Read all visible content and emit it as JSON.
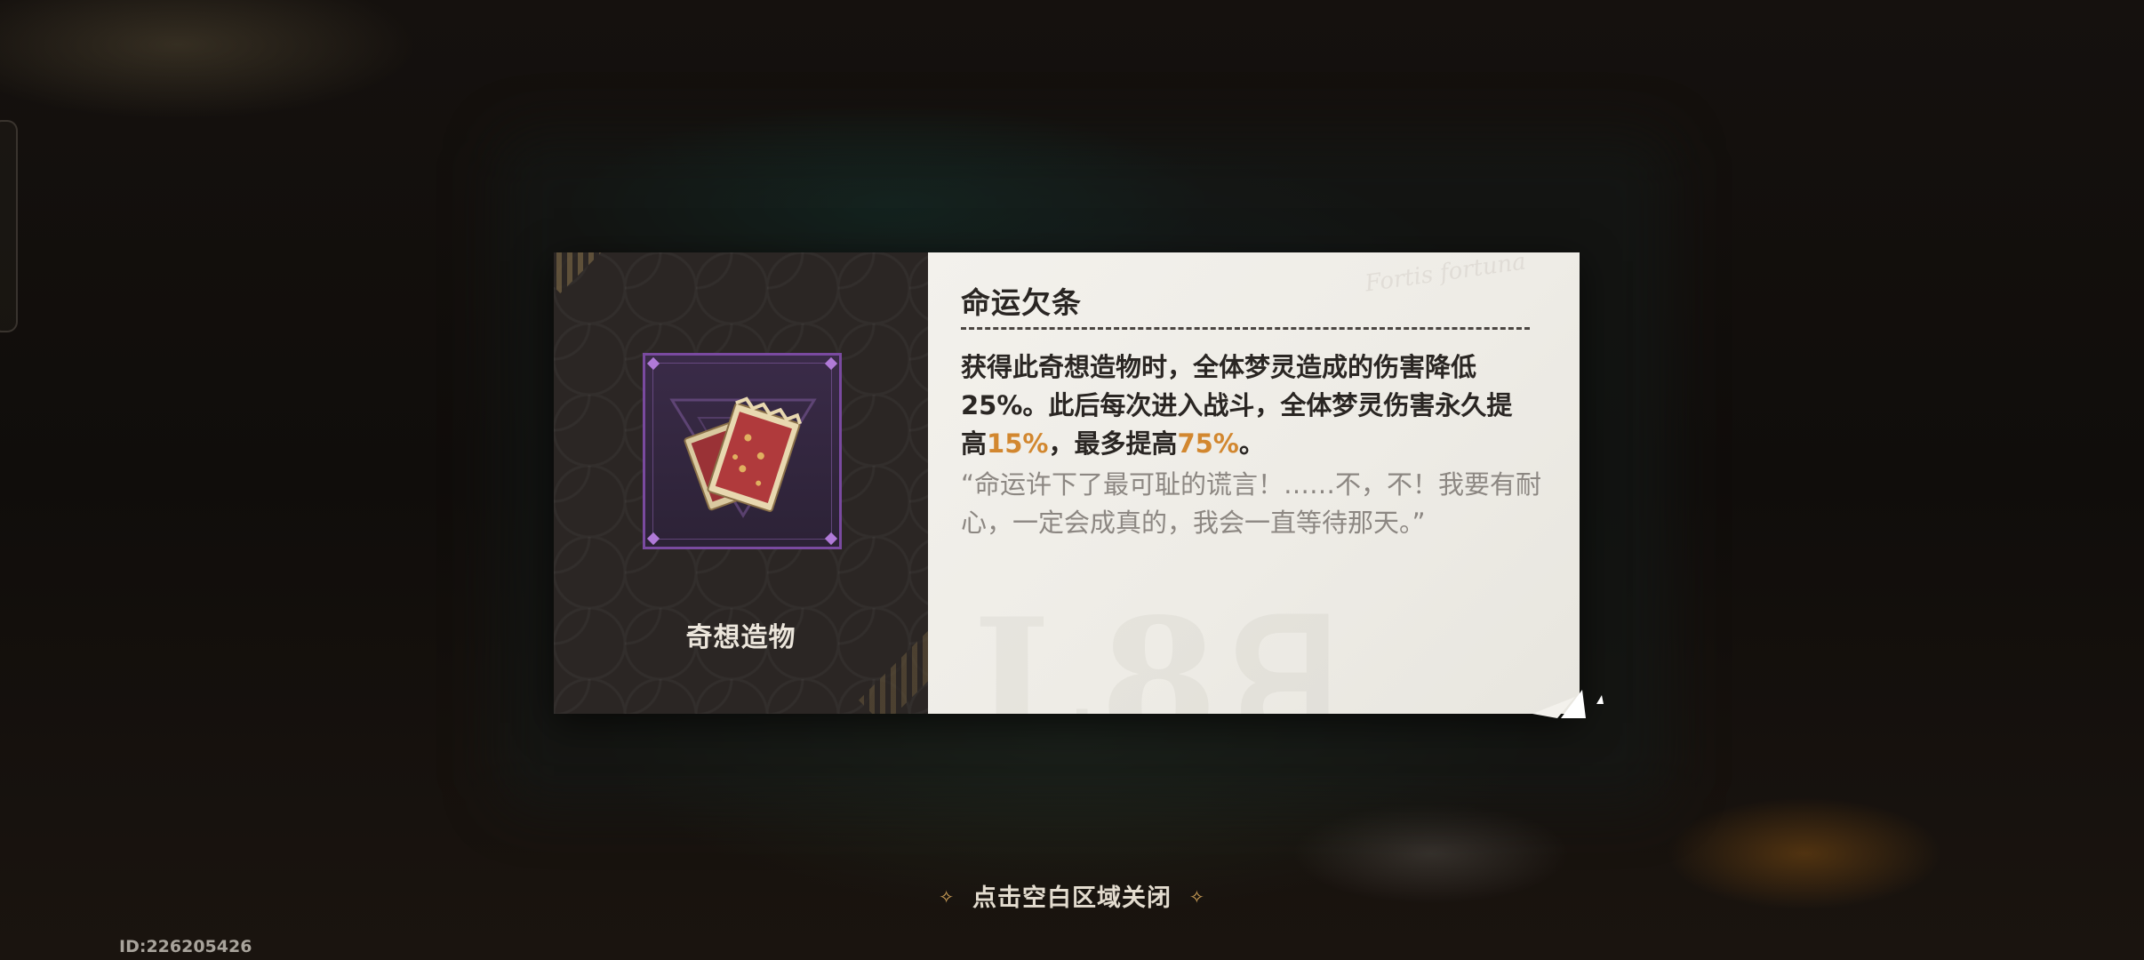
{
  "item": {
    "title": "命运欠条",
    "category": "奇想造物",
    "description": {
      "line1": "获得此奇想造物时，全体梦灵造成的伤害降低",
      "line2": "25%。此后每次进入战斗，全体梦灵伤害永久提",
      "line3_prefix": "高",
      "value_increase": "15%",
      "line3_mid": "，最多提高",
      "value_max": "75%",
      "line3_suffix": "。"
    },
    "flavor_text": "“命运许下了最可耻的谎言！……不，不！我要有耐心，一定会成真的，我会一直等待那天。”"
  },
  "close_hint": "点击空白区域关闭",
  "uid": "ID:226205426",
  "colors": {
    "highlight": "#d2872f",
    "frame_purple": "#7a4aa0",
    "card_dark": "#2b2624",
    "card_light": "#f3f1ec"
  },
  "icons": {
    "item": "fate-iou-ticket-icon",
    "hint": "diamond-sparkle-icon"
  }
}
